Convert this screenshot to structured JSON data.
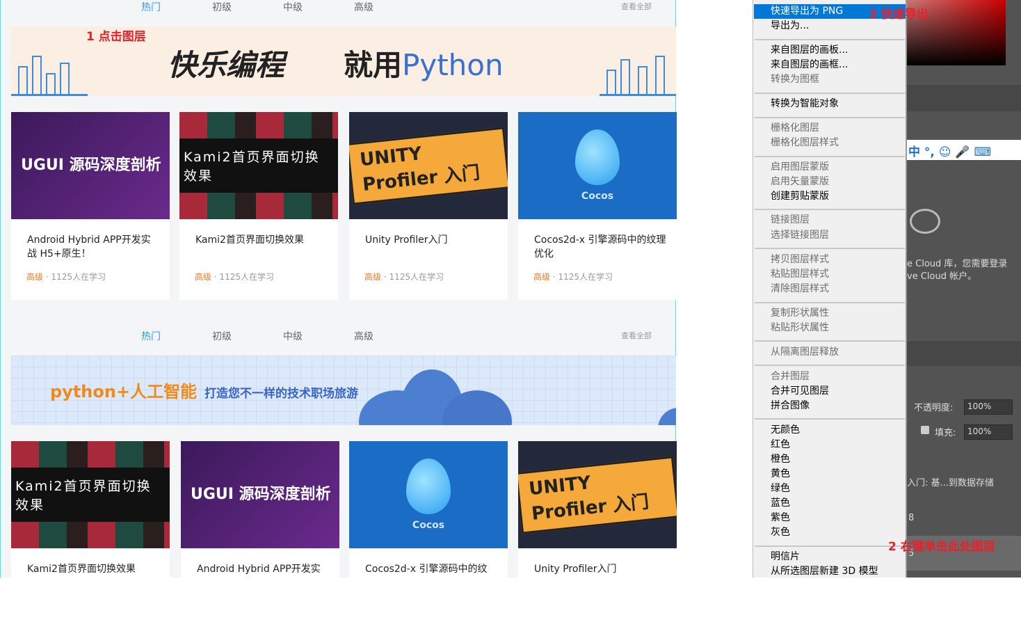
{
  "tabs": {
    "items": [
      "热门",
      "初级",
      "中级",
      "高级"
    ],
    "view_all": "查看全部"
  },
  "banner1": {
    "step": "1 点击图层",
    "text1": "快乐编程",
    "text2": "就用",
    "text3": "Python"
  },
  "banner2": {
    "text1": "python+人工智能",
    "text2": "打造您不一样的技术职场旅游"
  },
  "row1": [
    {
      "thumb": "UGUI 源码深度剖析",
      "title": "Android  Hybrid  APP开发实战 H5+原生！",
      "level": "高级",
      "learners": "1125人在学习"
    },
    {
      "thumb": "Kami2首页界面切换效果",
      "title": "Kami2首页界面切换效果",
      "level": "高级",
      "learners": "1125人在学习"
    },
    {
      "thumb": "UNITY Profiler 入门",
      "title": "Unity Profiler入门",
      "level": "高级",
      "learners": "1125人在学习"
    },
    {
      "thumb": "Cocos",
      "title": "Cocos2d-x    引擎源码中的纹理优化",
      "level": "高级",
      "learners": "1125人在学习"
    }
  ],
  "row2": [
    {
      "thumb": "Kami2首页界面切换效果",
      "title": "Kami2首页界面切换效果"
    },
    {
      "thumb": "UGUI 源码深度剖析",
      "title": "Android  Hybrid  APP开发实"
    },
    {
      "thumb": "Cocos",
      "title": "Cocos2d-x    引擎源码中的纹"
    },
    {
      "thumb": "UNITY Profiler 入门",
      "title": "Unity Profiler入门"
    }
  ],
  "menu": {
    "items": [
      {
        "label": "快速导出为 PNG",
        "state": "highlighted"
      },
      {
        "label": "导出为...",
        "state": "enabled"
      },
      {
        "label": "来自图层的画板...",
        "state": "enabled"
      },
      {
        "label": "来自图层的画框...",
        "state": "enabled"
      },
      {
        "label": "转换为图框",
        "state": "disabled"
      },
      {
        "label": "转换为智能对象",
        "state": "enabled"
      },
      {
        "label": "栅格化图层",
        "state": "disabled"
      },
      {
        "label": "栅格化图层样式",
        "state": "disabled"
      },
      {
        "label": "启用图层蒙版",
        "state": "disabled"
      },
      {
        "label": "启用矢量蒙版",
        "state": "disabled"
      },
      {
        "label": "创建剪贴蒙版",
        "state": "enabled"
      },
      {
        "label": "链接图层",
        "state": "disabled"
      },
      {
        "label": "选择链接图层",
        "state": "disabled"
      },
      {
        "label": "拷贝图层样式",
        "state": "disabled"
      },
      {
        "label": "粘贴图层样式",
        "state": "disabled"
      },
      {
        "label": "清除图层样式",
        "state": "disabled"
      },
      {
        "label": "复制形状属性",
        "state": "disabled"
      },
      {
        "label": "粘贴形状属性",
        "state": "disabled"
      },
      {
        "label": "从隔离图层释放",
        "state": "disabled"
      },
      {
        "label": "合并图层",
        "state": "disabled"
      },
      {
        "label": "合并可见图层",
        "state": "enabled"
      },
      {
        "label": "拼合图像",
        "state": "enabled"
      },
      {
        "label": "无颜色",
        "state": "enabled"
      },
      {
        "label": "红色",
        "state": "enabled"
      },
      {
        "label": "橙色",
        "state": "enabled"
      },
      {
        "label": "黄色",
        "state": "enabled"
      },
      {
        "label": "绿色",
        "state": "enabled"
      },
      {
        "label": "蓝色",
        "state": "enabled"
      },
      {
        "label": "紫色",
        "state": "enabled"
      },
      {
        "label": "灰色",
        "state": "enabled"
      },
      {
        "label": "明信片",
        "state": "enabled"
      },
      {
        "label": "从所选图层新建 3D 模型",
        "state": "enabled"
      }
    ]
  },
  "annotations": {
    "step3": "3 快速导出",
    "step2": "2 右键单击此处图层"
  },
  "ps_panel": {
    "ime": "中 °, ☺ 🎤 ⌨",
    "cloud_text1": "e Cloud 库，您需要登录",
    "cloud_text2": "ve Cloud 帐户。",
    "opacity_label": "不透明度:",
    "opacity_value": "100%",
    "fill_label": "填充:",
    "fill_value": "100%",
    "layer1": "入门:  基...到数据存储",
    "layer2": "8",
    "layer3": "5"
  }
}
